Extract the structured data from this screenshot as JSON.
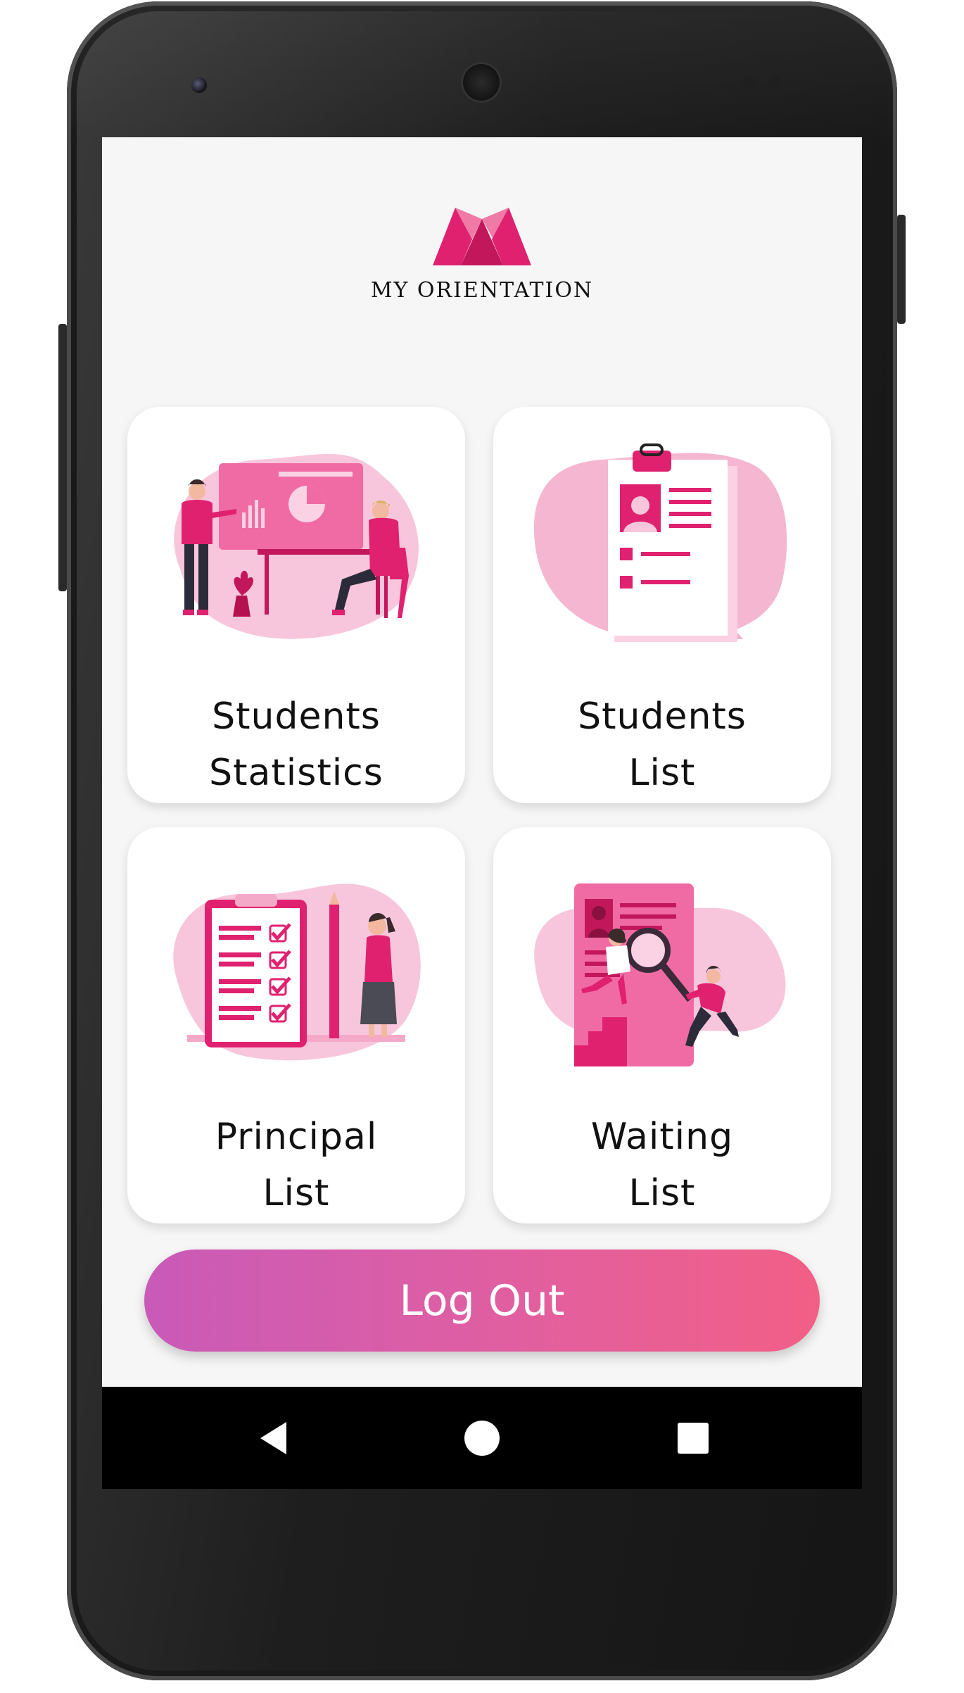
{
  "app": {
    "logo_text": "MY ORIENTATION",
    "brand_color": "#e0216f",
    "accent_gradient": [
      "#c95ab8",
      "#f25f86"
    ]
  },
  "tiles": [
    {
      "id": "students-statistics",
      "line1": "Students",
      "line2": "Statistics",
      "icon": "presentation-illustration"
    },
    {
      "id": "students-list",
      "line1": "Students",
      "line2": "List",
      "icon": "resume-clipboard-illustration"
    },
    {
      "id": "principal-list",
      "line1": "Principal",
      "line2": "List",
      "icon": "checklist-illustration"
    },
    {
      "id": "waiting-list",
      "line1": "Waiting",
      "line2": "List",
      "icon": "search-profile-illustration"
    }
  ],
  "logout": {
    "label": "Log Out"
  },
  "navbar": {
    "back_icon": "back-triangle-icon",
    "home_icon": "home-circle-icon",
    "recents_icon": "recents-square-icon"
  }
}
